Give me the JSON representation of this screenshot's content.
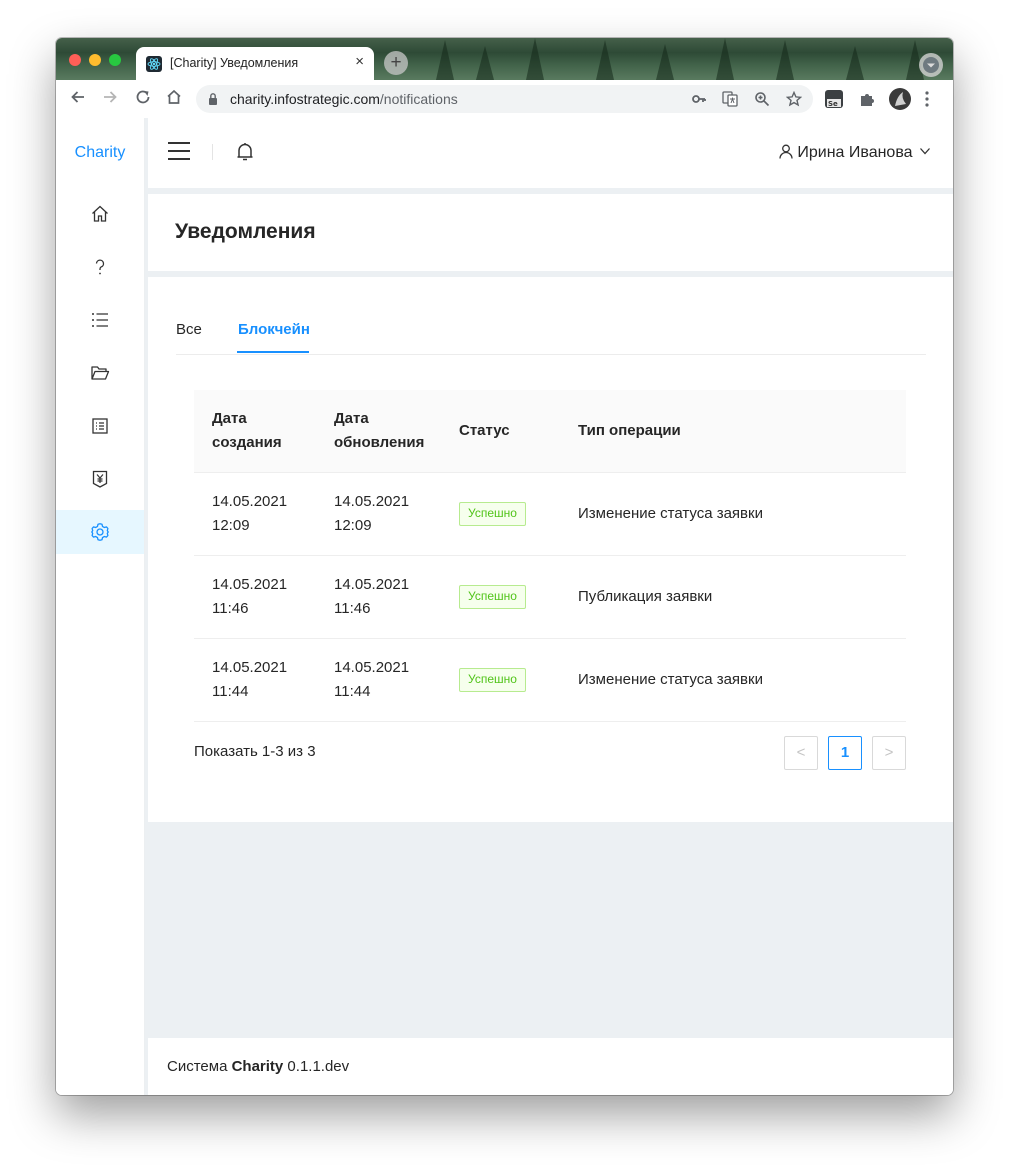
{
  "browser": {
    "tab_title": "[Charity] Уведомления",
    "tab_close": "×",
    "new_tab": "+",
    "url_host": "charity.infostrategic.com",
    "url_path": "/notifications"
  },
  "app": {
    "logo": "Charity",
    "user_name": "Ирина Иванова",
    "accent_color": "#1890ff",
    "sidebar_icons": [
      "home-icon",
      "question-icon",
      "list-icon",
      "folder-open-icon",
      "profile-icon",
      "money-collect-icon",
      "setting-icon"
    ],
    "active_sidebar_item": "setting-icon"
  },
  "page": {
    "title": "Уведомления"
  },
  "tabs": [
    {
      "label": "Все",
      "active": false
    },
    {
      "label": "Блокчейн",
      "active": true
    }
  ],
  "table": {
    "columns": [
      {
        "line1": "Дата",
        "line2": "создания"
      },
      {
        "line1": "Дата",
        "line2": "обновления"
      },
      {
        "line1": "Статус",
        "line2": ""
      },
      {
        "line1": "Тип операции",
        "line2": ""
      }
    ],
    "rows": [
      {
        "created_date": "14.05.2021",
        "created_time": "12:09",
        "updated_date": "14.05.2021",
        "updated_time": "12:09",
        "status": "Успешно",
        "operation": "Изменение статуса заявки"
      },
      {
        "created_date": "14.05.2021",
        "created_time": "11:46",
        "updated_date": "14.05.2021",
        "updated_time": "11:46",
        "status": "Успешно",
        "operation": "Публикация заявки"
      },
      {
        "created_date": "14.05.2021",
        "created_time": "11:44",
        "updated_date": "14.05.2021",
        "updated_time": "11:44",
        "status": "Успешно",
        "operation": "Изменение статуса заявки"
      }
    ]
  },
  "pagination": {
    "total_text": "Показать 1-3 из 3",
    "prev": "<",
    "current": "1",
    "next": ">"
  },
  "footer": {
    "prefix": "Система ",
    "brand": "Charity",
    "version": " 0.1.1.dev"
  }
}
